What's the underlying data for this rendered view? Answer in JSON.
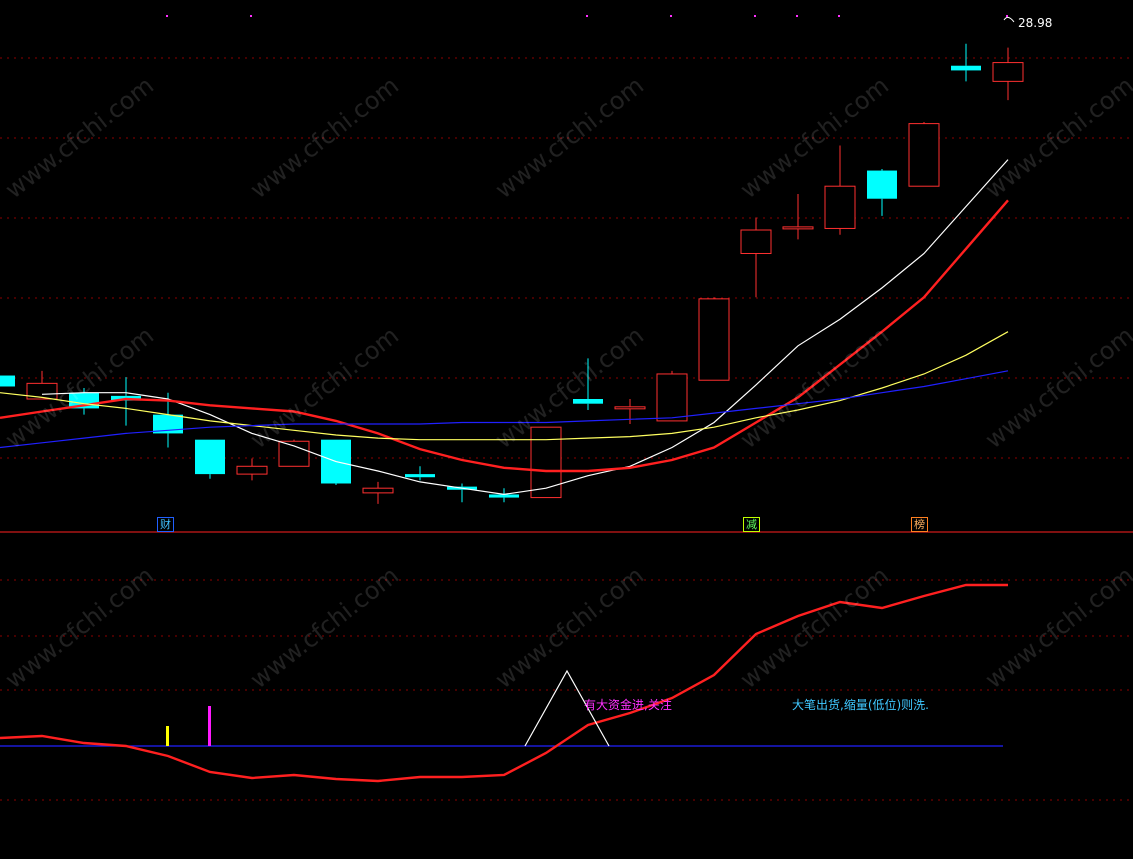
{
  "chart_data": [
    {
      "type": "candlestick",
      "title": "",
      "price_label": "28.98",
      "ylim": [
        13.5,
        30.5
      ],
      "candles": [
        {
          "o": 18.5,
          "h": 18.5,
          "l": 18.15,
          "c": 18.15,
          "dir": "down"
        },
        {
          "o": 17.75,
          "h": 18.65,
          "l": 17.75,
          "c": 18.25,
          "dir": "up"
        },
        {
          "o": 17.95,
          "h": 18.1,
          "l": 17.25,
          "c": 17.45,
          "dir": "down"
        },
        {
          "o": 17.85,
          "h": 18.45,
          "l": 16.9,
          "c": 17.7,
          "dir": "down"
        },
        {
          "o": 17.25,
          "h": 17.95,
          "l": 16.2,
          "c": 16.65,
          "dir": "down"
        },
        {
          "o": 16.45,
          "h": 16.45,
          "l": 15.2,
          "c": 15.35,
          "dir": "down"
        },
        {
          "o": 15.35,
          "h": 15.85,
          "l": 15.15,
          "c": 15.6,
          "dir": "up"
        },
        {
          "o": 15.6,
          "h": 16.45,
          "l": 15.6,
          "c": 16.4,
          "dir": "up"
        },
        {
          "o": 16.45,
          "h": 16.45,
          "l": 15.0,
          "c": 15.05,
          "dir": "down"
        },
        {
          "o": 14.75,
          "h": 15.1,
          "l": 14.4,
          "c": 14.9,
          "dir": "up"
        },
        {
          "o": 15.35,
          "h": 15.6,
          "l": 15.15,
          "c": 15.25,
          "dir": "down"
        },
        {
          "o": 14.95,
          "h": 15.05,
          "l": 14.45,
          "c": 14.85,
          "dir": "down"
        },
        {
          "o": 14.7,
          "h": 14.9,
          "l": 14.45,
          "c": 14.6,
          "dir": "down"
        },
        {
          "o": 14.6,
          "h": 16.85,
          "l": 14.6,
          "c": 16.85,
          "dir": "up"
        },
        {
          "o": 17.75,
          "h": 19.05,
          "l": 17.4,
          "c": 17.6,
          "dir": "down"
        },
        {
          "o": 17.5,
          "h": 17.75,
          "l": 16.95,
          "c": 17.5,
          "dir": "up"
        },
        {
          "o": 17.05,
          "h": 18.65,
          "l": 17.05,
          "c": 18.55,
          "dir": "up"
        },
        {
          "o": 18.35,
          "h": 21.0,
          "l": 18.35,
          "c": 20.95,
          "dir": "up"
        },
        {
          "o": 22.4,
          "h": 23.55,
          "l": 21.0,
          "c": 23.15,
          "dir": "up"
        },
        {
          "o": 23.2,
          "h": 24.3,
          "l": 22.85,
          "c": 23.25,
          "dir": "up"
        },
        {
          "o": 23.2,
          "h": 25.85,
          "l": 23.0,
          "c": 24.55,
          "dir": "up"
        },
        {
          "o": 25.05,
          "h": 25.1,
          "l": 23.6,
          "c": 24.15,
          "dir": "down"
        },
        {
          "o": 24.55,
          "h": 26.6,
          "l": 24.55,
          "c": 26.55,
          "dir": "up"
        },
        {
          "o": 28.4,
          "h": 29.1,
          "l": 27.9,
          "c": 28.25,
          "dir": "down"
        },
        {
          "o": 27.9,
          "h": 28.98,
          "l": 27.3,
          "c": 28.5,
          "dir": "up"
        }
      ],
      "series": [
        {
          "color": "#ffffff",
          "values": [
            null,
            17.9,
            17.95,
            17.95,
            17.75,
            17.25,
            16.65,
            16.25,
            15.75,
            15.45,
            15.1,
            14.9,
            14.7,
            14.9,
            15.3,
            15.6,
            16.2,
            17.0,
            18.2,
            19.45,
            20.3,
            21.3,
            22.4,
            23.9,
            25.4
          ]
        },
        {
          "color": "#ff2020",
          "values": [
            17.15,
            17.35,
            17.55,
            17.75,
            17.7,
            17.55,
            17.45,
            17.35,
            17.05,
            16.65,
            16.15,
            15.8,
            15.55,
            15.45,
            15.45,
            15.55,
            15.8,
            16.2,
            17.0,
            17.8,
            18.85,
            19.9,
            21.0,
            22.55,
            24.1
          ]
        },
        {
          "color": "#ffff60",
          "values": [
            17.95,
            17.8,
            17.6,
            17.45,
            17.25,
            17.05,
            16.9,
            16.75,
            16.6,
            16.5,
            16.45,
            16.45,
            16.45,
            16.45,
            16.5,
            16.55,
            16.65,
            16.85,
            17.15,
            17.4,
            17.7,
            18.1,
            18.55,
            19.15,
            19.9
          ]
        },
        {
          "color": "#2020ff",
          "values": [
            16.2,
            16.35,
            16.5,
            16.65,
            16.75,
            16.85,
            16.9,
            16.95,
            16.95,
            16.95,
            16.95,
            17.0,
            17.0,
            17.0,
            17.05,
            17.1,
            17.15,
            17.3,
            17.45,
            17.6,
            17.75,
            17.95,
            18.15,
            18.4,
            18.65
          ]
        }
      ],
      "tick_marks": [
        3,
        5,
        13,
        15,
        17,
        18,
        19,
        23
      ]
    },
    {
      "type": "line",
      "ylim": [
        0,
        100
      ],
      "series": [
        {
          "color": "#ff2020",
          "values": [
            40,
            42,
            35,
            32,
            22,
            6,
            0,
            3,
            -1,
            -3,
            1,
            1,
            3,
            25,
            53,
            65,
            80,
            103,
            144,
            162,
            176,
            170,
            182,
            193,
            193
          ]
        }
      ],
      "baseline": 32,
      "bars": [
        {
          "index": 3,
          "color": "#ffff00",
          "height": 20
        },
        {
          "index": 4,
          "color": "#ff1aff",
          "height": 40
        }
      ],
      "triangle": {
        "start": 12.5,
        "peak": 13.5,
        "end": 14.5,
        "height": 75,
        "color": "#ffffff"
      }
    }
  ],
  "markers": [
    {
      "text": "财",
      "color": "#40c0ff",
      "border": "#2060ff"
    },
    {
      "text": "减",
      "color": "#60ff60",
      "border": "#c0ff00"
    },
    {
      "text": "榜",
      "color": "#ffb060",
      "border": "#ff8020"
    }
  ],
  "notes": {
    "capital_in": "有大资金进,关注",
    "distribution": "大笔出货,缩量(低位)则洗."
  },
  "watermark": "www.cfchi.com",
  "colors": {
    "up": "#ff3030",
    "down": "#00ffff",
    "grid": "#8b0000",
    "divider": "#ff2020"
  }
}
